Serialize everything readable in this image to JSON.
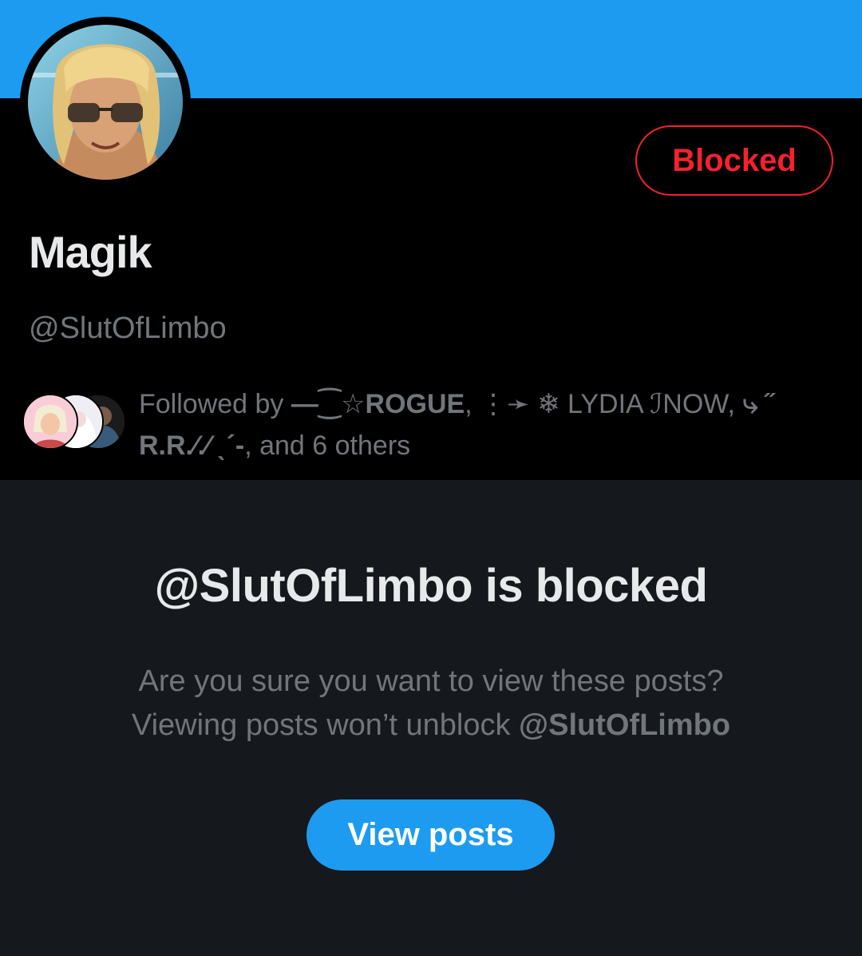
{
  "colors": {
    "banner": "#1d9bf0",
    "profile_bg": "#000000",
    "page_bg": "#15181c",
    "blocked_red": "#f4212e",
    "primary_text": "#e7e9ea",
    "secondary_text": "#71767b",
    "button_blue": "#1d9bf0"
  },
  "profile": {
    "display_name": "Magik",
    "handle": "@SlutOfLimbo",
    "block_button_label": "Blocked",
    "avatar_icon": "profile-avatar"
  },
  "followed_by": {
    "prefix": "Followed by ",
    "user1": "—⁐☆ROGUE",
    "sep1": ", ",
    "user2": "⋮➛ ❄ LYDIA ℐNOW",
    "sep2": ", ",
    "user3": "⤷ ˝ R.R.⁄.⁄ ˎ´-",
    "suffix": ", and 6 others"
  },
  "blocked_notice": {
    "title": "@SlutOfLimbo is blocked",
    "line1": "Are you sure you want to view these posts?",
    "line2_prefix": "Viewing posts won’t unblock ",
    "line2_handle": "@SlutOfLimbo",
    "button_label": "View posts"
  }
}
